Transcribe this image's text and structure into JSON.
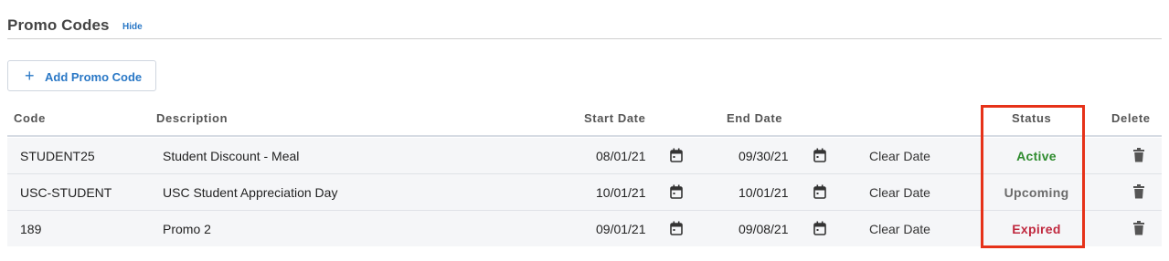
{
  "section": {
    "title": "Promo Codes",
    "hide_label": "Hide"
  },
  "add_button": {
    "label": "Add Promo Code"
  },
  "table": {
    "headers": {
      "code": "Code",
      "description": "Description",
      "start_date": "Start Date",
      "end_date": "End Date",
      "status": "Status",
      "delete": "Delete"
    },
    "rows": [
      {
        "code": "STUDENT25",
        "description": "Student Discount - Meal",
        "start_date": "08/01/21",
        "end_date": "09/30/21",
        "clear_label": "Clear Date",
        "status": "Active",
        "status_color": "#2e8b2e"
      },
      {
        "code": "USC-STUDENT",
        "description": "USC Student Appreciation Day",
        "start_date": "10/01/21",
        "end_date": "10/01/21",
        "clear_label": "Clear Date",
        "status": "Upcoming",
        "status_color": "#6b6b6b"
      },
      {
        "code": "189",
        "description": "Promo 2",
        "start_date": "09/01/21",
        "end_date": "09/08/21",
        "clear_label": "Clear Date",
        "status": "Expired",
        "status_color": "#c0293f"
      }
    ]
  },
  "icons": {
    "add": "plus-icon",
    "date": "calendar-icon",
    "delete": "trash-icon"
  },
  "colors": {
    "accent": "#2a78c6",
    "highlight_box": "#e63219"
  }
}
